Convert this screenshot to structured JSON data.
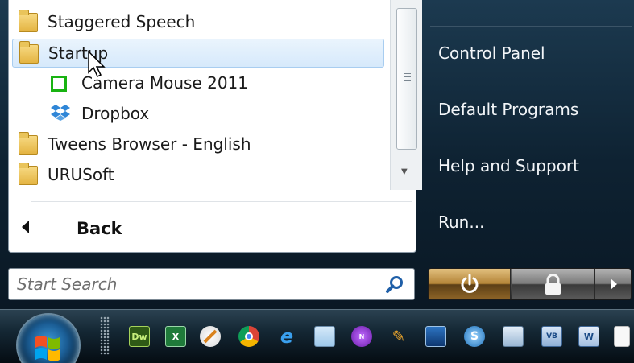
{
  "programs": [
    {
      "label": "Staggered Speech",
      "icon": "folder-icon",
      "level": 0,
      "selected": false
    },
    {
      "label": "Startup",
      "icon": "folder-icon",
      "level": 0,
      "selected": true
    },
    {
      "label": "Camera Mouse 2011",
      "icon": "camera-mouse-icon",
      "level": 1,
      "selected": false
    },
    {
      "label": "Dropbox",
      "icon": "dropbox-icon",
      "level": 1,
      "selected": false
    },
    {
      "label": "Tweens Browser - English",
      "icon": "folder-icon",
      "level": 0,
      "selected": false
    },
    {
      "label": "URUSoft",
      "icon": "folder-icon",
      "level": 0,
      "selected": false
    }
  ],
  "back_label": "Back",
  "search": {
    "placeholder": "Start Search"
  },
  "right_items": [
    "Control Panel",
    "Default Programs",
    "Help and Support",
    "Run..."
  ],
  "taskbar": {
    "icons": [
      "dreamweaver-icon",
      "excel-icon",
      "paint-icon",
      "chrome-icon",
      "ie-icon",
      "notepad-icon",
      "nvu-icon",
      "tools-icon",
      "desktop-icon",
      "sync-icon",
      "window-icon",
      "vb-icon",
      "word-icon",
      "document-icon"
    ],
    "dw_text": "Dw"
  },
  "colors": {
    "selection": "#d6e9fb",
    "folder": "#e4b442",
    "camera_mouse": "#19b312",
    "dropbox": "#2f86d7"
  }
}
